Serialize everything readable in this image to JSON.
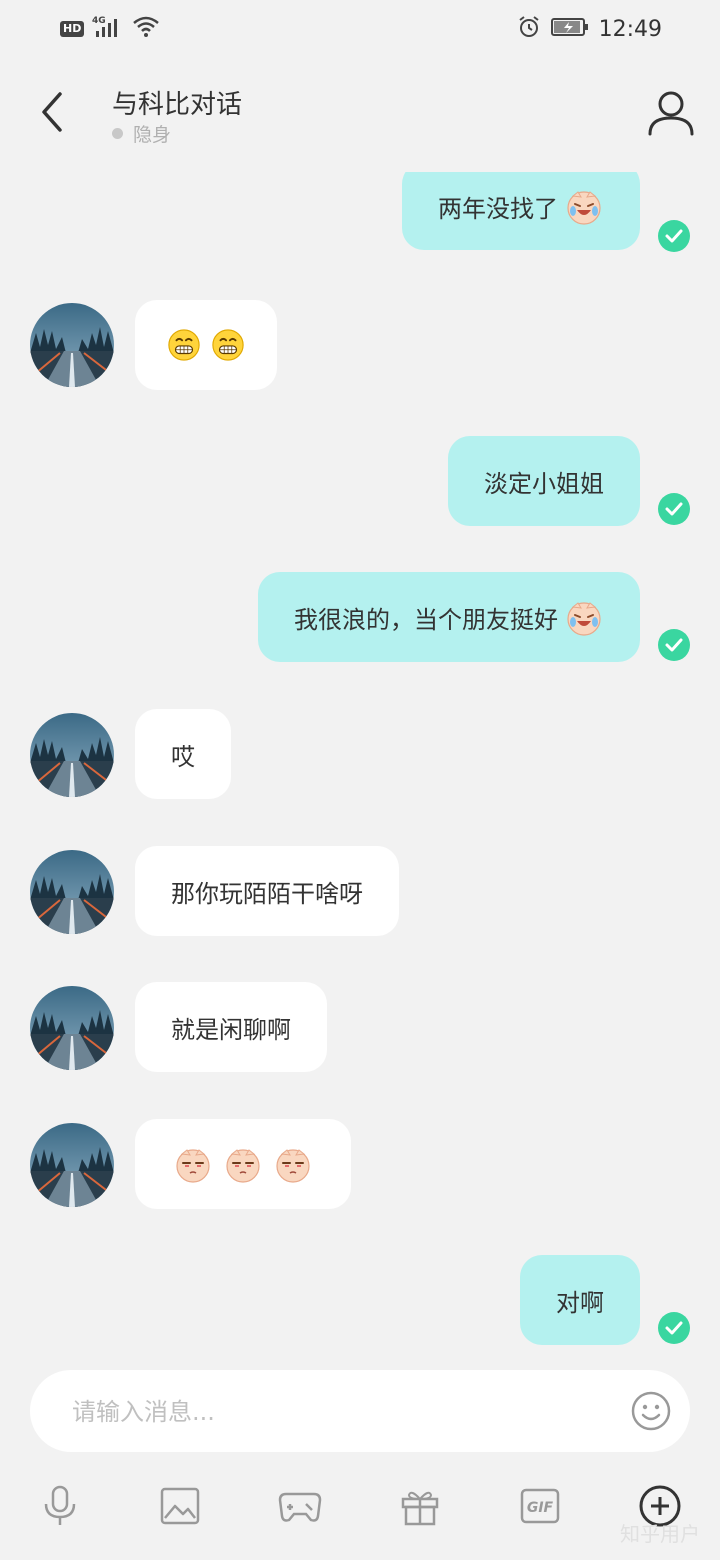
{
  "status_bar": {
    "network_badge": "HD",
    "network_type": "4G",
    "time": "12:49"
  },
  "header": {
    "title": "与科比对话",
    "status": "隐身"
  },
  "messages": [
    {
      "sender": "me",
      "text": "两年没找了",
      "emoji": "laugh-cry-face",
      "read": true
    },
    {
      "sender": "them",
      "text": "",
      "emoji": "grin-face x2"
    },
    {
      "sender": "me",
      "text": "淡定小姐姐",
      "read": true
    },
    {
      "sender": "me",
      "text": "我很浪的，当个朋友挺好",
      "emoji": "laugh-cry-face",
      "read": true
    },
    {
      "sender": "them",
      "text": "哎"
    },
    {
      "sender": "them",
      "text": "那你玩陌陌干啥呀"
    },
    {
      "sender": "them",
      "text": "就是闲聊啊"
    },
    {
      "sender": "them",
      "text": "",
      "emoji": "smirk-face x3"
    },
    {
      "sender": "me",
      "text": "对啊",
      "read": true
    }
  ],
  "input": {
    "placeholder": "请输入消息..."
  },
  "toolbar": {
    "items": [
      "microphone-icon",
      "image-icon",
      "game-icon",
      "gift-icon",
      "gif-icon",
      "plus-circle-icon"
    ],
    "gif_label": "GIF"
  },
  "watermark": "知乎用户",
  "colors": {
    "background": "#f2f2f2",
    "my_bubble": "#b4f1ef",
    "their_bubble": "#ffffff",
    "read_check": "#3ad6a0"
  }
}
